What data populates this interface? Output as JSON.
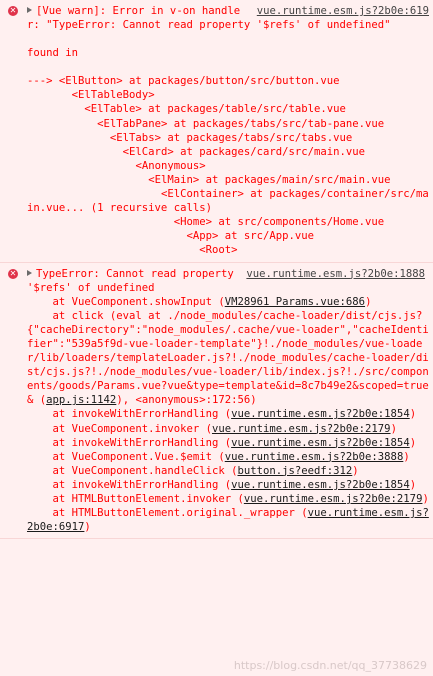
{
  "msg1": {
    "icon": "error-icon",
    "source": "vue.runtime.esm.js?2b0e:619",
    "text1": "[Vue warn]: Error in v-on handler: \"TypeError: Cannot read property '$refs' of undefined\"",
    "found_in": "found in",
    "tree": [
      {
        "indent": "---> ",
        "text": "<ElButton> at packages/button/src/button.vue"
      },
      {
        "indent": "       ",
        "text": "<ElTableBody>"
      },
      {
        "indent": "         ",
        "text": "<ElTable> at packages/table/src/table.vue"
      },
      {
        "indent": "           ",
        "text": "<ElTabPane> at packages/tabs/src/tab-pane.vue"
      },
      {
        "indent": "             ",
        "text": "<ElTabs> at packages/tabs/src/tabs.vue"
      },
      {
        "indent": "               ",
        "text": "<ElCard> at packages/card/src/main.vue"
      },
      {
        "indent": "                 ",
        "text": "<Anonymous>"
      },
      {
        "indent": "                   ",
        "text": "<ElMain> at packages/main/src/main.vue"
      },
      {
        "indent": "                     ",
        "text": "<ElContainer> at packages/container/src/main.vue... (1 recursive calls)"
      },
      {
        "indent": "                       ",
        "text": "<Home> at src/components/Home.vue"
      },
      {
        "indent": "                         ",
        "text": "<App> at src/App.vue"
      },
      {
        "indent": "                           ",
        "text": "<Root>"
      }
    ]
  },
  "msg2": {
    "icon": "error-icon",
    "source": "vue.runtime.esm.js?2b0e:1888",
    "text1": "TypeError: Cannot read property '$refs' of undefined",
    "frames": [
      {
        "pre": "    at VueComponent.showInput (",
        "link": "VM28961 Params.vue:686",
        "post": ")"
      },
      {
        "pre": "    at click (eval at ./node_modules/cache-loader/dist/cjs.js?{\"cacheDirectory\":\"node_modules/.cache/vue-loader\",\"cacheIdentifier\":\"539a5f9d-vue-loader-template\"}!./node_modules/vue-loader/lib/loaders/templateLoader.js?!./node_modules/cache-loader/dist/cjs.js?!./node_modules/vue-loader/lib/index.js?!./src/components/goods/Params.vue?vue&type=template&id=8c7b49e2&scoped=true& (",
        "link": "app.js:1142",
        "post": "), <anonymous>:172:56)"
      },
      {
        "pre": "    at invokeWithErrorHandling (",
        "link": "vue.runtime.esm.js?2b0e:1854",
        "post": ")"
      },
      {
        "pre": "    at VueComponent.invoker (",
        "link": "vue.runtime.esm.js?2b0e:2179",
        "post": ")"
      },
      {
        "pre": "    at invokeWithErrorHandling (",
        "link": "vue.runtime.esm.js?2b0e:1854",
        "post": ")"
      },
      {
        "pre": "    at VueComponent.Vue.$emit (",
        "link": "vue.runtime.esm.js?2b0e:3888",
        "post": ")"
      },
      {
        "pre": "    at VueComponent.handleClick (",
        "link": "button.js?eedf:312",
        "post": ")"
      },
      {
        "pre": "    at invokeWithErrorHandling (",
        "link": "vue.runtime.esm.js?2b0e:1854",
        "post": ")"
      },
      {
        "pre": "    at HTMLButtonElement.invoker (",
        "link": "vue.runtime.esm.js?2b0e:2179",
        "post": ")"
      },
      {
        "pre": "    at HTMLButtonElement.original._wrapper (",
        "link": "vue.runtime.esm.js?2b0e:6917",
        "post": ")"
      }
    ]
  },
  "watermark": "https://blog.csdn.net/qq_37738629"
}
